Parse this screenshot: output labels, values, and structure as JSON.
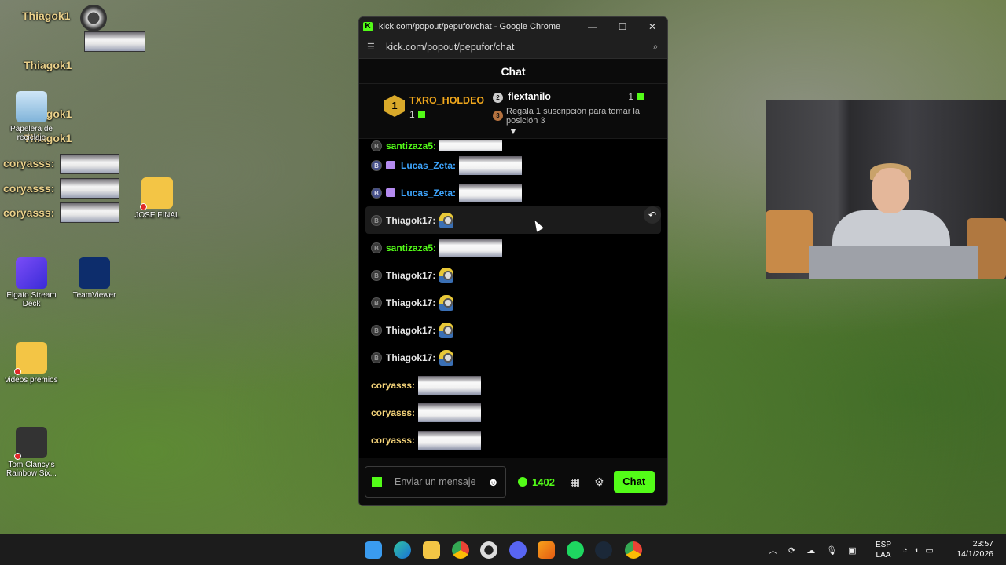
{
  "desktop": {
    "icons": [
      {
        "label": "Papelera de reciclaje",
        "icon": "recycle-bin-icon"
      },
      {
        "label": "JOSE FINAL",
        "icon": "folder-icon"
      },
      {
        "label": "Elgato Stream Deck",
        "icon": "stream-deck-icon"
      },
      {
        "label": "TeamViewer",
        "icon": "teamviewer-icon"
      },
      {
        "label": "videos premios",
        "icon": "folder-icon"
      },
      {
        "label": "Tom Clancy's Rainbow Six...",
        "icon": "rainbow-six-icon"
      }
    ],
    "overlay_names": [
      "Thiagok1",
      "Thiagok1",
      "Thiagok1",
      "Thiagok1",
      "coryasss:",
      "coryasss:",
      "coryasss:"
    ]
  },
  "browser": {
    "title": "kick.com/popout/pepufor/chat - Google Chrome",
    "url": "kick.com/popout/pepufor/chat",
    "controls": {
      "minimize": "—",
      "maximize": "☐",
      "close": "✕"
    }
  },
  "chat": {
    "header": "Chat",
    "leaderboard": {
      "first": {
        "rank": "1",
        "name": "TXRO_HOLDEO",
        "count": "1"
      },
      "second": {
        "rank": "2",
        "name": "flextanilo",
        "count": "1"
      },
      "third": {
        "rank": "3",
        "promo": "Regala 1 suscripción para tomar la posición 3"
      }
    },
    "messages": [
      {
        "user": "santizaza5:",
        "color": "#53fc18",
        "emote": "face",
        "partial": true
      },
      {
        "user": "Lucas_Zeta:",
        "color": "#3ea6ff",
        "emote": "face",
        "badge": "blue",
        "sub": true
      },
      {
        "user": "Lucas_Zeta:",
        "color": "#3ea6ff",
        "emote": "face",
        "badge": "blue",
        "sub": true
      },
      {
        "user": "Thiagok17:",
        "color": "#e6e6e6",
        "emote": "minion",
        "highlight": true
      },
      {
        "user": "santizaza5:",
        "color": "#53fc18",
        "emote": "face"
      },
      {
        "user": "Thiagok17:",
        "color": "#e6e6e6",
        "emote": "minion"
      },
      {
        "user": "Thiagok17:",
        "color": "#e6e6e6",
        "emote": "minion"
      },
      {
        "user": "Thiagok17:",
        "color": "#e6e6e6",
        "emote": "minion"
      },
      {
        "user": "Thiagok17:",
        "color": "#e6e6e6",
        "emote": "minion"
      },
      {
        "user": "coryasss:",
        "color": "#f5d47a",
        "emote": "face",
        "nobadge": true
      },
      {
        "user": "coryasss:",
        "color": "#f5d47a",
        "emote": "face",
        "nobadge": true
      },
      {
        "user": "coryasss:",
        "color": "#f5d47a",
        "emote": "face",
        "nobadge": true
      }
    ],
    "input_placeholder": "Enviar un mensaje",
    "points": "1402",
    "send_label": "Chat"
  },
  "taskbar": {
    "language": "ESP",
    "layout": "LAA",
    "time": "23:57",
    "date": "14/1/2026"
  },
  "colors": {
    "kick_green": "#53fc18",
    "gold": "#f0a71c"
  }
}
